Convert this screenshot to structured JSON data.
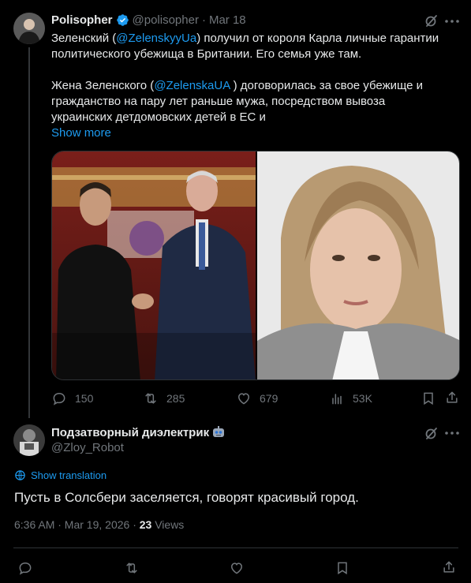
{
  "post": {
    "author_name": "Polisopher",
    "author_handle": "@polisopher",
    "separator": "·",
    "date": "Mar 18",
    "text_line1_prefix": "Зеленский (",
    "mention1": "@ZelenskyyUa",
    "text_line1_suffix": ") получил от короля Карла личные гарантии",
    "text_line2": "политического убежища в Британии. Его семья уже там.",
    "text_line3_prefix": "Жена Зеленского (",
    "mention2": "@ZelenskaUA",
    "text_line3_suffix": " ) договорилась за свое убежище и",
    "text_line4": "гражданство на пару лет раньше мужа, посредством вывоза",
    "text_line5": "украинских детдомовских детей в ЕС и",
    "show_more": "Show more",
    "stats": {
      "replies": "150",
      "reposts": "285",
      "likes": "679",
      "views": "53K"
    }
  },
  "reply": {
    "author_name": "Подзатворный диэлектрик",
    "author_handle": "@Zloy_Robot",
    "show_translation": "Show translation",
    "text": "Пусть в Солсбери заселяется, говорят красивый город.",
    "time": "6:36 AM · Mar 19, 2026 · ",
    "views_count": "23",
    "views_label": " Views"
  },
  "colors": {
    "accent": "#1d9bf0",
    "muted": "#71767b",
    "text": "#e7e9ea",
    "background": "#000000"
  }
}
